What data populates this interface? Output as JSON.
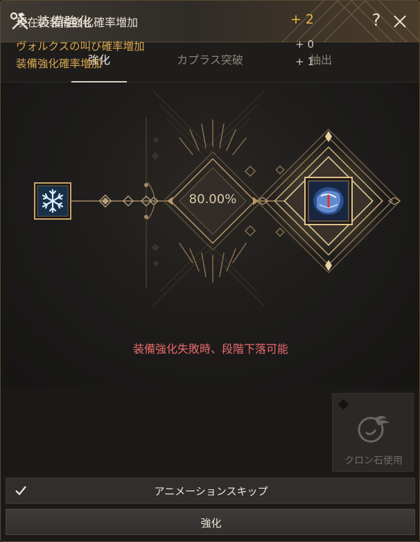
{
  "window": {
    "title": "装備強化",
    "help_label": "?",
    "close_icon": "close-icon",
    "title_icon": "hammer-wrench-icon"
  },
  "tabs": [
    {
      "label": "強化",
      "active": true
    },
    {
      "label": "カプラス突破",
      "active": false
    },
    {
      "label": "抽出",
      "active": false
    }
  ],
  "enhance": {
    "success_rate": "80.00%",
    "warning": "装備強化失敗時、段階下落可能",
    "item_icon": "snowflake-icon",
    "result_icon": "crystal-stone-icon"
  },
  "stats": {
    "main_label": "現在の装備強化確率増加",
    "main_value": "+ 2",
    "rows": [
      {
        "label": "ヴォルクスの叫び確率増加",
        "value": "+ 0"
      },
      {
        "label": "装備強化確率増加",
        "value": "+ 1"
      }
    ]
  },
  "cron": {
    "label": "クロン石使用",
    "icon": "cron-stone-icon"
  },
  "buttons": {
    "animation_skip": "アニメーションスキップ",
    "animation_skip_checked": true,
    "enhance": "強化"
  },
  "colors": {
    "accent_gold": "#e8b445",
    "warning_red": "#ea6b6b",
    "frame_gold": "#b08a52"
  }
}
